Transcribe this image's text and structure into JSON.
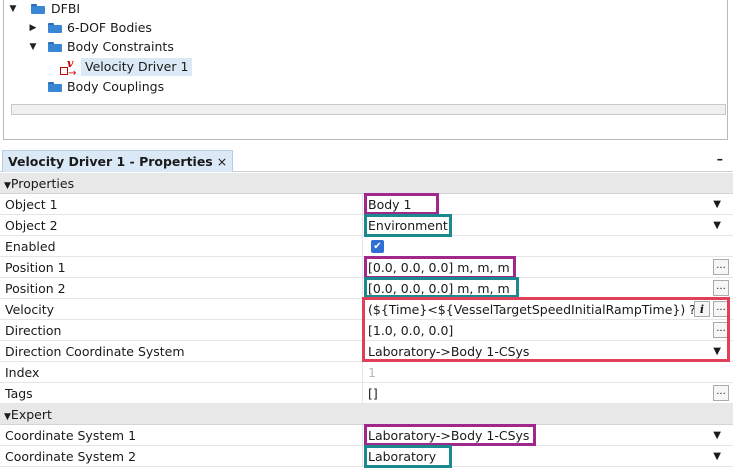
{
  "tree": {
    "nodes": [
      {
        "id": "dfbi",
        "label": "DFBI",
        "toggle": "▼"
      },
      {
        "id": "sixdof",
        "label": "6-DOF Bodies",
        "toggle": "▶"
      },
      {
        "id": "constraints",
        "label": "Body Constraints",
        "toggle": "▼"
      },
      {
        "id": "vdriver",
        "label": "Velocity Driver 1",
        "icon_glyph": "v",
        "arrow": "→"
      },
      {
        "id": "couplings",
        "label": "Body Couplings"
      }
    ]
  },
  "properties_panel": {
    "tab_label": "Velocity Driver 1 - Properties",
    "tab_close": "×",
    "minimize": "–",
    "sections": {
      "properties": {
        "toggle": "▼",
        "label": "Properties"
      },
      "expert": {
        "toggle": "▼",
        "label": "Expert"
      }
    },
    "rows": {
      "object1": {
        "label": "Object 1",
        "value": "Body 1"
      },
      "object2": {
        "label": "Object 2",
        "value": "Environment"
      },
      "enabled": {
        "label": "Enabled",
        "check": "✔"
      },
      "position1": {
        "label": "Position 1",
        "value": "[0.0, 0.0, 0.0] m, m, m"
      },
      "position2": {
        "label": "Position 2",
        "value": "[0.0, 0.0, 0.0] m, m, m"
      },
      "velocity": {
        "label": "Velocity",
        "value": "(${Time}<${VesselTargetSpeedInitialRampTime}) ? $",
        "info": "i"
      },
      "direction": {
        "label": "Direction",
        "value": "[1.0, 0.0, 0.0]"
      },
      "dircs": {
        "label": "Direction Coordinate System",
        "value": "Laboratory->Body 1-CSys"
      },
      "index": {
        "label": "Index",
        "value": "1"
      },
      "tags": {
        "label": "Tags",
        "value": "[]"
      },
      "cs1": {
        "label": "Coordinate System 1",
        "value": "Laboratory->Body 1-CSys"
      },
      "cs2": {
        "label": "Coordinate System 2",
        "value": "Laboratory"
      }
    },
    "controls": {
      "dropdown": "▼",
      "ellipsis": "..."
    }
  },
  "colors": {
    "highlight_purple": "#a0288c",
    "highlight_teal": "#1a8a8f",
    "highlight_red": "#e0405a",
    "selection": "#dbe8f5",
    "tab_background": "#dbe9f7"
  }
}
